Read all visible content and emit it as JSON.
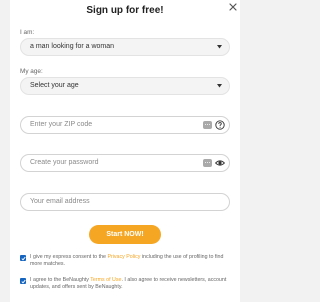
{
  "header": {
    "title": "Sign up for free!"
  },
  "form": {
    "iam_label": "I am:",
    "iam_value": "a man looking for a woman",
    "age_label": "My age:",
    "age_value": "Select your age",
    "zip_placeholder": "Enter your ZIP code",
    "password_placeholder": "Create your password",
    "email_placeholder": "Your email address",
    "submit_label": "Start NOW!"
  },
  "consents": [
    {
      "checked": true,
      "text_before": "I give my express consent to the ",
      "link": "Privacy Policy",
      "text_after": " including the use of profiling to find more matches."
    },
    {
      "checked": true,
      "text_before": "I agree to the BeNaughty ",
      "link": "Terms of Use",
      "text_after": ". I also agree to receive newsletters, account updates, and offers sent by BeNaughty."
    }
  ],
  "colors": {
    "accent": "#f5a623",
    "checkbox": "#1565c0"
  },
  "icons": [
    "close-icon",
    "chevron-down-icon",
    "key-icon",
    "help-icon",
    "eye-icon"
  ]
}
